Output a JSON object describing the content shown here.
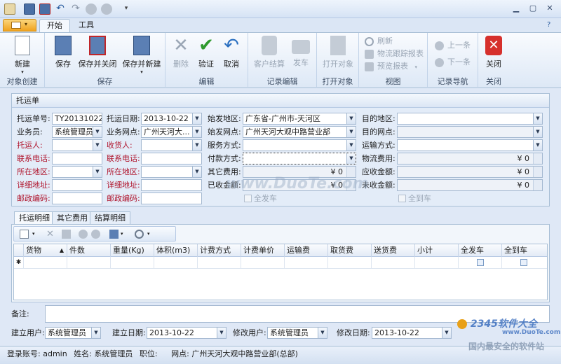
{
  "quick_access": [
    "doc-icon",
    "save-icon",
    "save-close-icon",
    "undo-icon",
    "redo-icon",
    "up-icon",
    "down-icon"
  ],
  "menu_tabs": [
    "开始",
    "工具"
  ],
  "ribbon": {
    "groups": [
      "对象创建",
      "保存",
      "编辑",
      "记录编辑",
      "打开对象",
      "视图",
      "记录导航",
      "关闭"
    ],
    "buttons": {
      "new": "新建",
      "save": "保存",
      "save_close": "保存并关闭",
      "save_new": "保存并新建",
      "delete": "删除",
      "validate": "验证",
      "cancel": "取消",
      "customer_settle": "客户结算",
      "ship": "发车",
      "open_object": "打开对象",
      "refresh": "刷新",
      "track_report": "物流跟踪报表",
      "preview_report": "预览报表",
      "prev": "上一条",
      "next": "下一条",
      "close": "关闭"
    }
  },
  "form": {
    "caption": "托运单",
    "labels": {
      "order_no": "托运单号:",
      "order_date": "托运日期:",
      "ship_region": "始发地区:",
      "dest_region": "目的地区:",
      "salesman": "业务员:",
      "sales_point": "业务网点:",
      "ship_point": "始发网点:",
      "dest_point": "目的网点:",
      "shipper": "托运人:",
      "consignee": "收货人:",
      "service_mode": "服务方式:",
      "transport_mode": "运输方式:",
      "shipper_phone": "联系电话:",
      "consignee_phone": "联系电话:",
      "pay_mode": "付款方式:",
      "logistics_fee": "物流费用:",
      "shipper_region": "所在地区:",
      "consignee_region": "所在地区:",
      "other_fee": "其它费用:",
      "receivable": "应收金额:",
      "shipper_addr": "详细地址:",
      "consignee_addr": "详细地址:",
      "received": "已收金额:",
      "unreceived": "未收金额:",
      "shipper_zip": "邮政编码:",
      "consignee_zip": "邮政编码:",
      "all_shipped": "全发车",
      "all_arrived": "全到车"
    },
    "values": {
      "order_no": "TY201310220",
      "order_date": "2013-10-22",
      "ship_region": "广东省-广州市-天河区",
      "salesman": "系统管理员",
      "sales_point": "广州天河大...",
      "ship_point": "广州天河大观中路营业部",
      "logistics_fee": "¥ 0",
      "other_fee": "¥ 0",
      "receivable": "¥ 0",
      "received": "¥ 0",
      "unreceived": "¥ 0"
    }
  },
  "detail_tabs": [
    "托运明细",
    "其它费用",
    "结算明细"
  ],
  "grid": {
    "columns": [
      "货物",
      "件数",
      "重量(Kg)",
      "体积(m3)",
      "计费方式",
      "计费单价",
      "运输费",
      "取货费",
      "送货费",
      "小计",
      "全发车",
      "全到车"
    ],
    "new_row_marker": "✱"
  },
  "footer": {
    "memo_label": "备注:",
    "created_by_label": "建立用户:",
    "created_by": "系统管理员",
    "created_date_label": "建立日期:",
    "created_date": "2013-10-22",
    "modified_by_label": "修改用户:",
    "modified_by": "系统管理员",
    "modified_date_label": "修改日期:",
    "modified_date": "2013-10-22"
  },
  "status": {
    "account_label": "登录账号:",
    "account": "admin",
    "name_label": "姓名:",
    "name": "系统管理员",
    "position_label": "职位:",
    "point_label": "网点:",
    "point": "广州天河大观中路营业部(总部)"
  },
  "watermark": {
    "duote": "www.DuoTe.com",
    "brand": "2345软件大全",
    "brand_url": "www.DuoTe.com",
    "slogan": "国内最安全的软件站"
  },
  "colors": {
    "accent": "#2a5d9f",
    "required_label": "#b0142c",
    "ribbon_bg": "#dde8f6"
  }
}
